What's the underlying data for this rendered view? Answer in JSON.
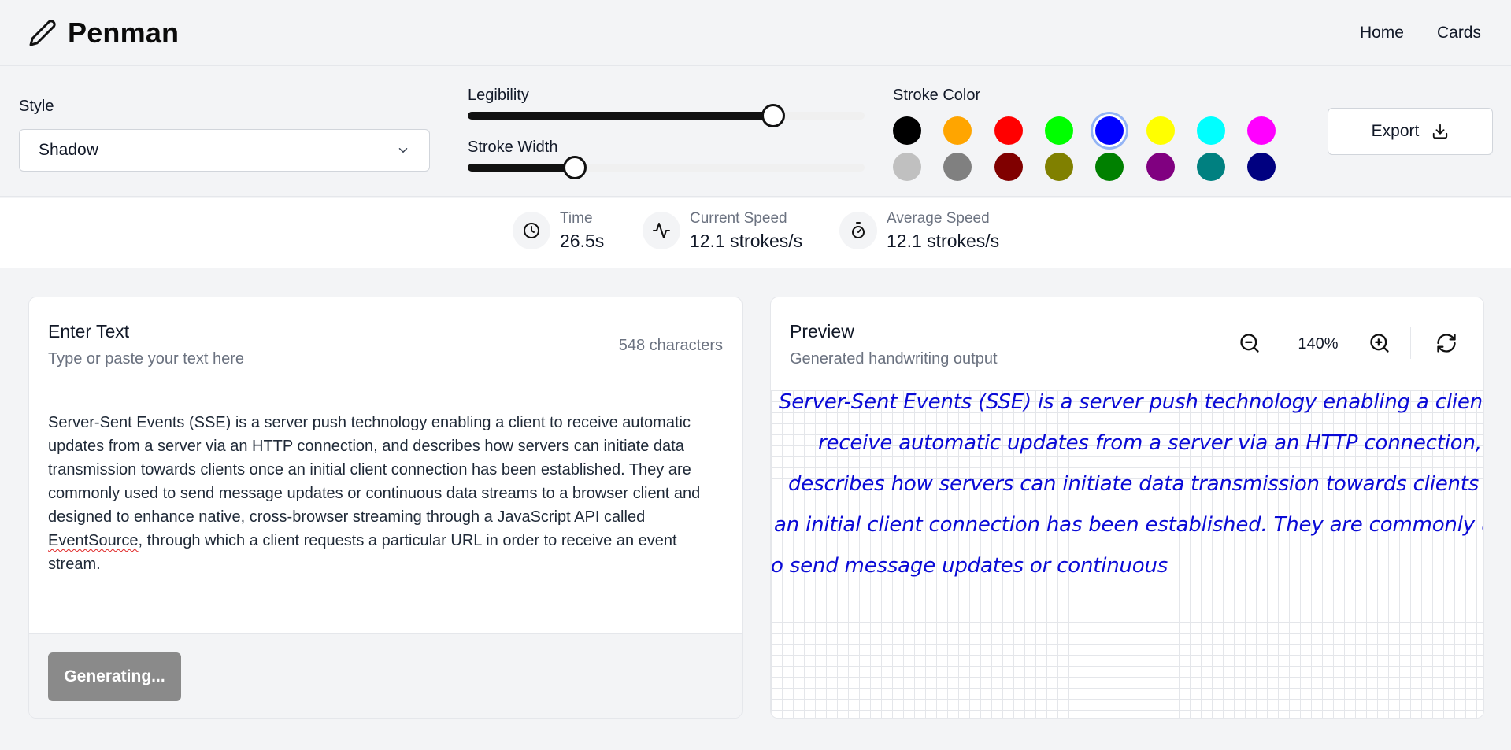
{
  "header": {
    "brand": "Penman",
    "nav": [
      "Home",
      "Cards"
    ]
  },
  "controls": {
    "style_label": "Style",
    "style_value": "Shadow",
    "legibility_label": "Legibility",
    "legibility_value": 0.77,
    "stroke_width_label": "Stroke Width",
    "stroke_width_value": 0.27,
    "stroke_color_label": "Stroke Color",
    "colors": [
      "#000000",
      "#ffa500",
      "#ff0000",
      "#00ff00",
      "#0000ff",
      "#ffff00",
      "#00ffff",
      "#ff00ff",
      "#c0c0c0",
      "#808080",
      "#800000",
      "#808000",
      "#008000",
      "#800080",
      "#008080",
      "#000080"
    ],
    "selected_color": "#0000ff",
    "export_label": "Export"
  },
  "stats": {
    "time_label": "Time",
    "time_value": "26.5s",
    "current_speed_label": "Current Speed",
    "current_speed_value": "12.1 strokes/s",
    "average_speed_label": "Average Speed",
    "average_speed_value": "12.1 strokes/s"
  },
  "input_panel": {
    "title": "Enter Text",
    "subtitle": "Type or paste your text here",
    "char_count": "548 characters",
    "text_before": "Server-Sent Events (SSE) is a server push technology enabling a client to receive automatic updates from a server via an HTTP connection, and describes how servers can initiate data transmission towards clients once an initial client connection has been established. They are commonly used to send message updates or continuous data streams to a browser client and designed to enhance native, cross-browser streaming through a JavaScript API called ",
    "text_misspelled": "EventSource",
    "text_after": ", through which a client requests a particular URL in order to receive an event stream.",
    "generate_label": "Generating..."
  },
  "preview_panel": {
    "title": "Preview",
    "subtitle": "Generated handwriting output",
    "zoom_level": "140%",
    "handwriting_lines": [
      "Server-Sent Events (SSE) is a server push technology enabling a client to",
      "receive automatic updates from a server via an HTTP connection, and",
      "describes how servers can initiate data transmission towards clients once",
      "an initial client connection has been established. They are commonly used",
      "o send message updates or continuous"
    ]
  }
}
